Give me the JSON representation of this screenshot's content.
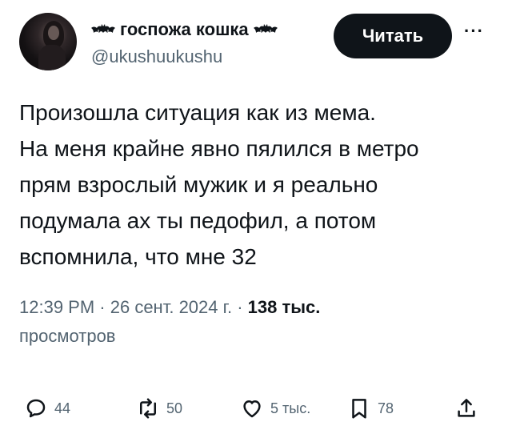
{
  "author": {
    "display_name": "госпожа кошка",
    "handle": "@ukushuukushu",
    "emoji_left": "bat-emoji",
    "emoji_right": "bat-emoji"
  },
  "follow_label": "Читать",
  "more_label": "···",
  "tweet_lines": [
    "Произошла ситуация как из мема.",
    "На меня крайне явно пялился в метро",
    "прям взрослый мужик и я реально",
    "подумала ах ты педофил, а потом",
    "вспомнила, что мне 32"
  ],
  "meta": {
    "time": "12:39 PM",
    "separator": " · ",
    "date": "26 сент. 2024 г.",
    "views_count": "138 тыс.",
    "views_label": "просмотров"
  },
  "actions": {
    "replies": "44",
    "retweets": "50",
    "likes": "5 тыс.",
    "bookmarks": "78"
  },
  "icons": {
    "reply": "reply-icon",
    "retweet": "retweet-icon",
    "like": "heart-icon",
    "bookmark": "bookmark-icon",
    "share": "share-icon"
  }
}
